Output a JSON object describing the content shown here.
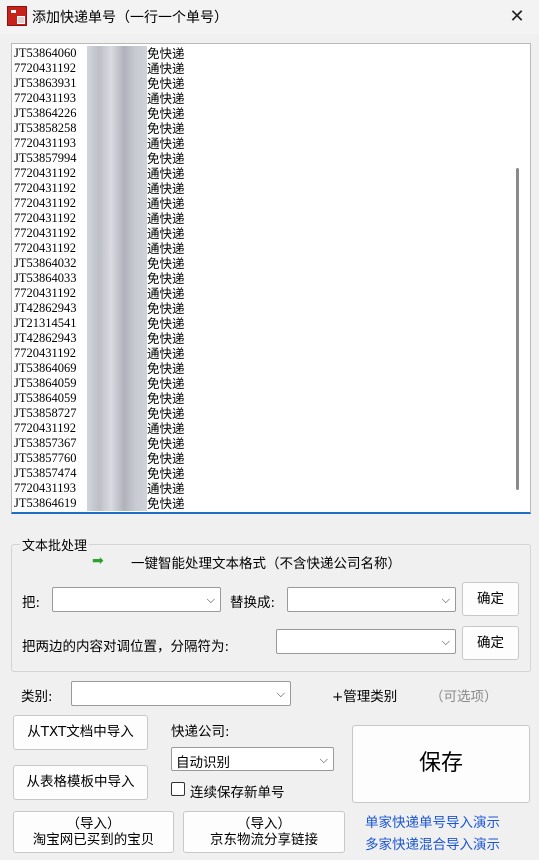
{
  "window": {
    "title": "添加快递单号（一行一个单号）",
    "close_glyph": "✕"
  },
  "tracking_list": [
    {
      "no": "JT53864060",
      "type": "免快递"
    },
    {
      "no": "7720431192",
      "type": "通快递"
    },
    {
      "no": "JT53863931",
      "type": "免快递"
    },
    {
      "no": "7720431193",
      "type": "通快递"
    },
    {
      "no": "JT53864226",
      "type": "免快递"
    },
    {
      "no": "JT53858258",
      "type": "免快递"
    },
    {
      "no": "7720431193",
      "type": "通快递"
    },
    {
      "no": "JT53857994",
      "type": "免快递"
    },
    {
      "no": "7720431192",
      "type": "通快递"
    },
    {
      "no": "7720431192",
      "type": "通快递"
    },
    {
      "no": "7720431192",
      "type": "通快递"
    },
    {
      "no": "7720431192",
      "type": "通快递"
    },
    {
      "no": "7720431192",
      "type": "通快递"
    },
    {
      "no": "7720431192",
      "type": "通快递"
    },
    {
      "no": "JT53864032",
      "type": "免快递"
    },
    {
      "no": "JT53864033",
      "type": "免快递"
    },
    {
      "no": "7720431192",
      "type": "通快递"
    },
    {
      "no": "JT42862943",
      "type": "免快递"
    },
    {
      "no": "JT21314541",
      "type": "免快递"
    },
    {
      "no": "JT42862943",
      "type": "免快递"
    },
    {
      "no": "7720431192",
      "type": "通快递"
    },
    {
      "no": "JT53864069",
      "type": "免快递"
    },
    {
      "no": "JT53864059",
      "type": "免快递"
    },
    {
      "no": "JT53864059",
      "type": "免快递"
    },
    {
      "no": "JT53858727",
      "type": "免快递"
    },
    {
      "no": "7720431192",
      "type": "通快递"
    },
    {
      "no": "JT53857367",
      "type": "免快递"
    },
    {
      "no": "JT53857760",
      "type": "免快递"
    },
    {
      "no": "JT53857474",
      "type": "免快递"
    },
    {
      "no": "7720431193",
      "type": "通快递"
    },
    {
      "no": "JT53864619",
      "type": "免快递"
    }
  ],
  "batch": {
    "legend": "文本批处理",
    "smart_format": "一键智能处理文本格式（不含快递公司名称）",
    "replace_from_label": "把:",
    "replace_to_label": "替换成:",
    "confirm_label": "确定",
    "swap_label": "把两边的内容对调位置，分隔符为:",
    "confirm2_label": "确定"
  },
  "category": {
    "label": "类别:",
    "manage_label": "+管理类别",
    "optional_label": "（可选项）"
  },
  "courier": {
    "label": "快递公司:",
    "selected": "自动识别"
  },
  "buttons": {
    "import_txt": "从TXT文档中导入",
    "import_excel": "从表格模板中导入",
    "import_taobao_line1": "（导入）",
    "import_taobao_line2": "淘宝网已买到的宝贝",
    "import_jd_line1": "（导入）",
    "import_jd_line2": "京东物流分享链接",
    "save": "保存"
  },
  "continuous_save_label": "连续保存新单号",
  "demo_links": {
    "single": "单家快递单号导入演示",
    "multi": "多家快递混合导入演示"
  },
  "colors": {
    "accent_blue": "#1a55d6",
    "arrow_green": "#2ca02c",
    "icon_red": "#c8221d"
  },
  "icons": {
    "arrow": "➡",
    "chevron": "⌵"
  }
}
